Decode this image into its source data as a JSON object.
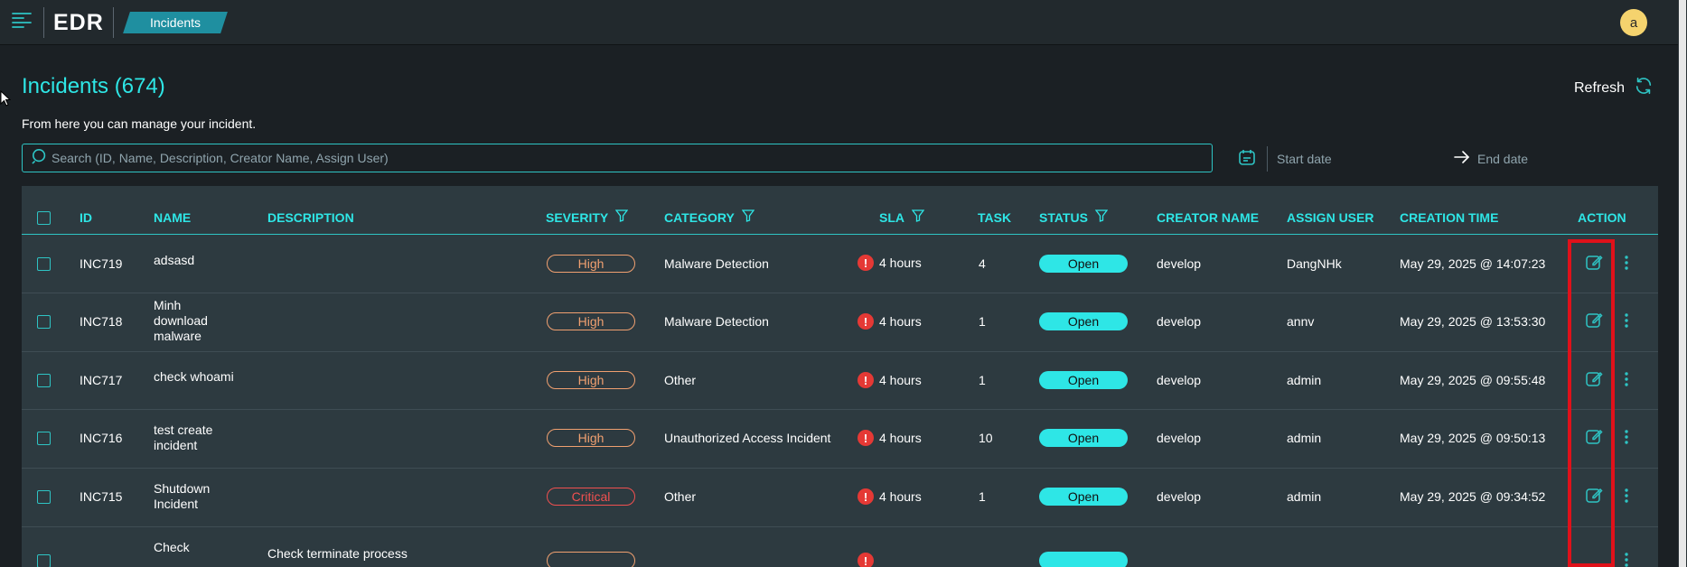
{
  "app": {
    "logo": "EDR",
    "breadcrumb": "Incidents",
    "avatar_initial": "a"
  },
  "header": {
    "title": "Incidents (674)",
    "subtitle": "From here you can manage your incident.",
    "refresh_label": "Refresh"
  },
  "search": {
    "placeholder": "Search (ID, Name, Description, Creator Name, Assign User)",
    "value": ""
  },
  "date_range": {
    "start_placeholder": "Start date",
    "end_placeholder": "End date"
  },
  "table": {
    "columns": {
      "id": "ID",
      "name": "NAME",
      "description": "DESCRIPTION",
      "severity": "SEVERITY",
      "category": "CATEGORY",
      "sla": "SLA",
      "task": "TASK",
      "status": "STATUS",
      "creator": "CREATOR NAME",
      "assign": "ASSIGN USER",
      "created": "CREATION TIME",
      "action": "ACTION"
    },
    "rows": [
      {
        "id": "INC719",
        "name": "adsasd",
        "description": "",
        "severity": "High",
        "category": "Malware Detection",
        "sla": "4 hours",
        "task": "4",
        "status": "Open",
        "creator": "develop",
        "assign": "DangNHk",
        "created": "May 29, 2025 @ 14:07:23"
      },
      {
        "id": "INC718",
        "name": "Minh\ndownload\nmalware",
        "description": "",
        "severity": "High",
        "category": "Malware Detection",
        "sla": "4 hours",
        "task": "1",
        "status": "Open",
        "creator": "develop",
        "assign": "annv",
        "created": "May 29, 2025 @ 13:53:30"
      },
      {
        "id": "INC717",
        "name": "check whoami",
        "description": "",
        "severity": "High",
        "category": "Other",
        "sla": "4 hours",
        "task": "1",
        "status": "Open",
        "creator": "develop",
        "assign": "admin",
        "created": "May 29, 2025 @ 09:55:48"
      },
      {
        "id": "INC716",
        "name": "test create\nincident",
        "description": "",
        "severity": "High",
        "category": "Unauthorized Access Incident",
        "sla": "4 hours",
        "task": "10",
        "status": "Open",
        "creator": "develop",
        "assign": "admin",
        "created": "May 29, 2025 @ 09:50:13"
      },
      {
        "id": "INC715",
        "name": "Shutdown\nIncident",
        "description": "",
        "severity": "Critical",
        "category": "Other",
        "sla": "4 hours",
        "task": "1",
        "status": "Open",
        "creator": "develop",
        "assign": "admin",
        "created": "May 29, 2025 @ 09:34:52"
      },
      {
        "id": "",
        "name": "Check",
        "description": "Check terminate process",
        "severity": "",
        "category": "",
        "sla": "",
        "task": "",
        "status": "",
        "creator": "",
        "assign": "",
        "created": ""
      }
    ]
  },
  "colors": {
    "accent": "#2ee6e6",
    "high": "#f0a070",
    "critical": "#f05050",
    "highlight": "#e0111a"
  }
}
